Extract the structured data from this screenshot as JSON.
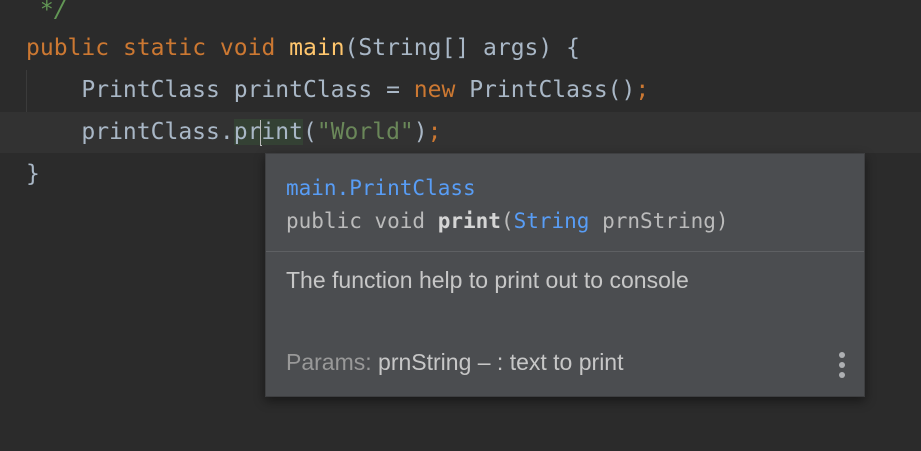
{
  "editor": {
    "comment_end": " */",
    "line1": {
      "kw1": "public",
      "kw2": "static",
      "kw3": "void",
      "fn": "main",
      "rest": "(String[] args) {"
    },
    "line2": {
      "type": "PrintClass",
      "var": "printClass",
      "eq": "=",
      "kw": "new",
      "call": "PrintClass()",
      "semi": ";"
    },
    "line3": {
      "obj": "printClass.",
      "method_a": "pr",
      "method_b": "int",
      "open": "(",
      "str": "\"World\"",
      "close": ")",
      "semi": ";"
    },
    "line4": {
      "brace": "}"
    }
  },
  "popup": {
    "class_name": "main.PrintClass",
    "sig_prefix": "public void ",
    "sig_name": "print",
    "sig_open": "(",
    "sig_type": "String",
    "sig_param": " prnString)",
    "description": "The function help to print out to console",
    "params_label": "Params:",
    "params_value": " prnString – : text to print",
    "more_icon": "vertical-ellipsis-icon"
  },
  "colors": {
    "background": "#2b2b2b",
    "keyword": "#cc7832",
    "function": "#ffc66d",
    "string": "#6a8759",
    "text": "#a9b7c6",
    "link": "#589df6",
    "popup_bg": "#4b4d50"
  }
}
